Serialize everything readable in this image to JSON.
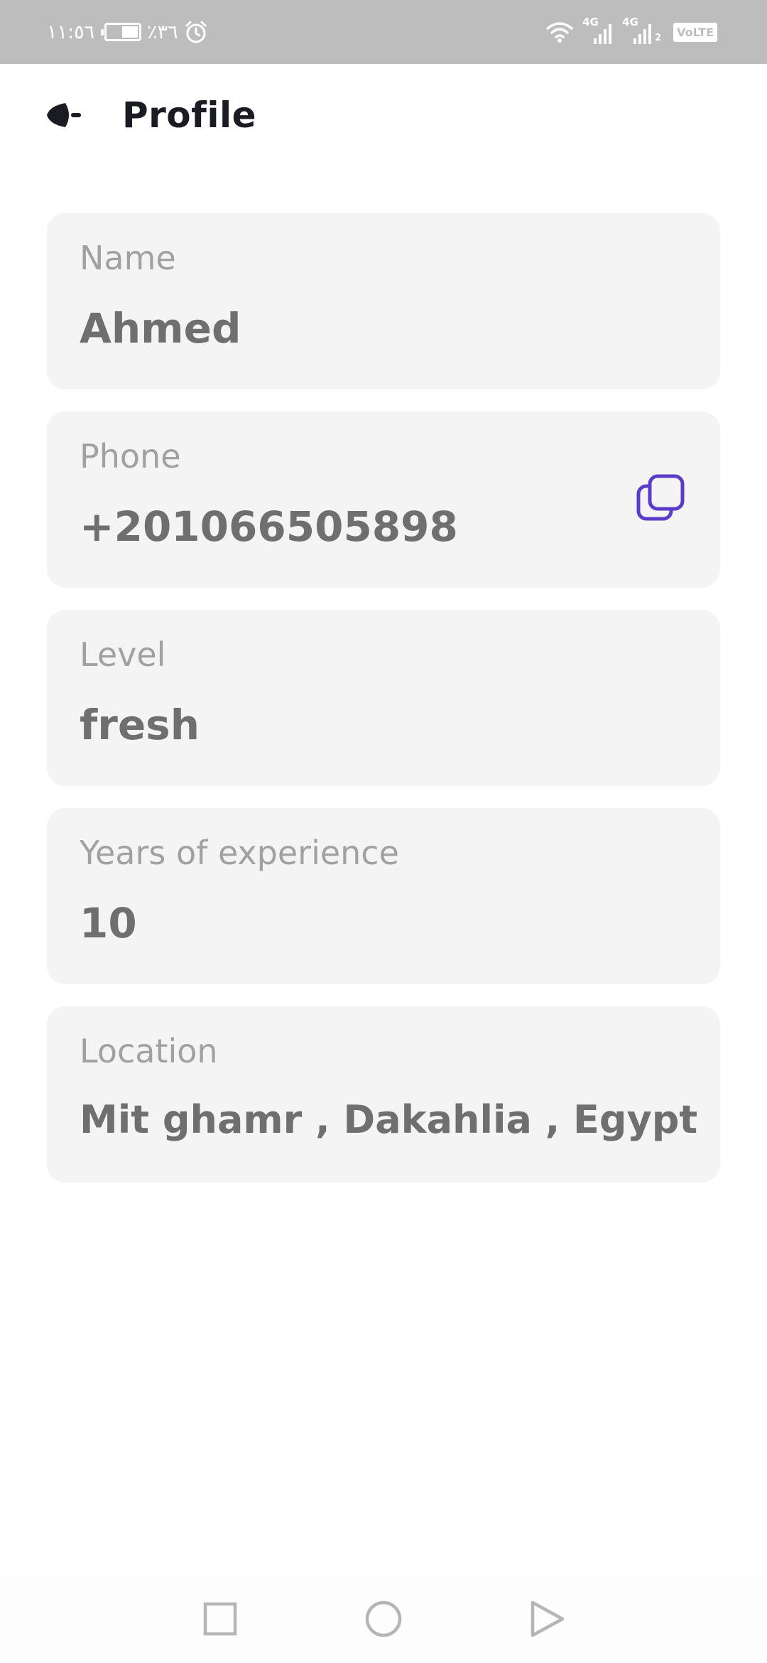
{
  "status_bar": {
    "time": "١١:٥٦",
    "battery_percent": "٪٣٦",
    "network_1": "4G",
    "network_2": "4G",
    "sim_2_label": "2",
    "volte": "VoLTE",
    "icons": [
      "battery-icon",
      "alarm-icon",
      "wifi-icon",
      "signal-icon",
      "signal-icon",
      "volte-icon"
    ]
  },
  "header": {
    "title": "Profile",
    "back_icon": "back-arrow-icon"
  },
  "fields": [
    {
      "label": "Name",
      "value": "Ahmed"
    },
    {
      "label": "Phone",
      "value": "+201066505898",
      "action_icon": "copy-icon",
      "action_color": "#5b3bc9"
    },
    {
      "label": "Level",
      "value": "fresh"
    },
    {
      "label": "Years of experience",
      "value": "10"
    },
    {
      "label": "Location",
      "value": "Mit ghamr , Dakahlia , Egypt"
    }
  ],
  "nav_bar": {
    "icons": [
      "recents-square-icon",
      "home-circle-icon",
      "back-triangle-icon"
    ]
  },
  "colors": {
    "accent": "#5b3bc9",
    "card_background": "#f4f4f4",
    "label": "#a1a1a1",
    "value": "#6f6f6f",
    "title": "#1b1b24",
    "status_bar": "#bdbdbd"
  }
}
